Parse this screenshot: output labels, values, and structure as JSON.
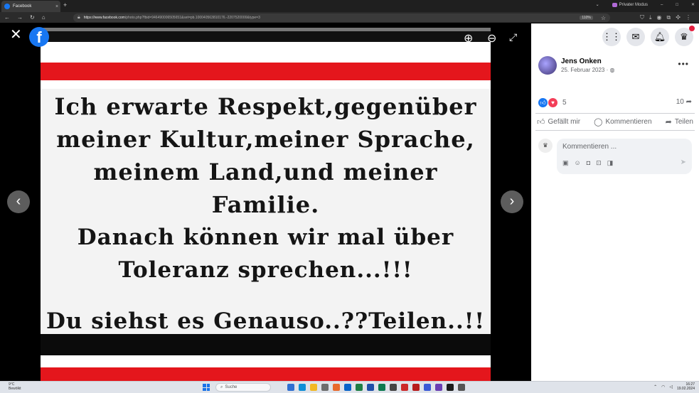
{
  "browser": {
    "tab_title": "Facebook",
    "tab_close": "×",
    "new_tab": "+",
    "private_mode": "Privater Modus",
    "url_host": "https://www.facebook.com",
    "url_path": "/photo.php?fbid=946490006505651&set=pb.100040563810176.-2207520000&type=3",
    "zoom_level": "110%",
    "back": "←",
    "forward": "→",
    "reload": "↻",
    "home": "⌂"
  },
  "viewer": {
    "close": "✕",
    "logo": "f",
    "zoom_in": "⊕",
    "zoom_out": "⊖",
    "fullscreen": "⤢",
    "prev": "‹",
    "next": "›"
  },
  "image_text": {
    "lines": [
      "Ich erwarte Respekt,gegenüber",
      "meiner Kultur,meiner Sprache,",
      "meinem Land,und meiner",
      "Familie.",
      "Danach können wir mal über",
      "Toleranz sprechen...!!!"
    ],
    "bottom": "Du siehst es Genauso..??Teilen..!!"
  },
  "panel": {
    "icons": [
      "grid-icon",
      "messenger-icon",
      "bell-icon",
      "profile-icon"
    ],
    "author_name": "Jens Onken",
    "post_date": "25. Februar 2023 ·",
    "privacy_icon": "◍",
    "more": "•••",
    "reaction_count": "5",
    "share_count": "10",
    "like_label": "Gefällt mir",
    "comment_label": "Kommentieren",
    "share_label": "Teilen",
    "comment_placeholder": "Kommentieren ..."
  },
  "taskbar": {
    "weather_temp": "9°C",
    "weather_desc": "Bewölkt",
    "search_label": "Suche",
    "time": "16:27",
    "date": "19.02.2024"
  }
}
